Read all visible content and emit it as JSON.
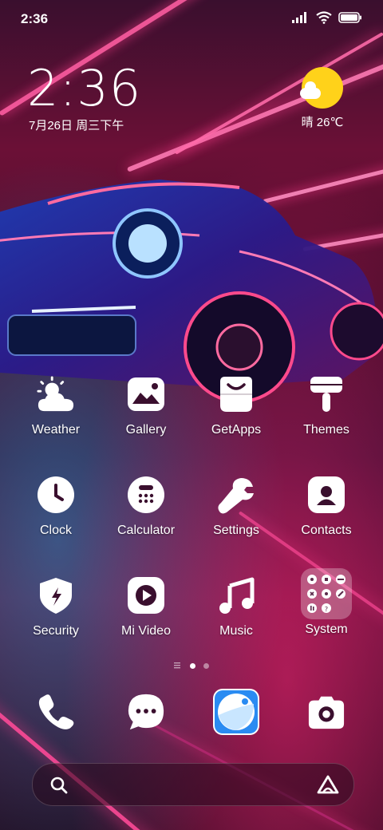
{
  "status_bar": {
    "time": "2:36"
  },
  "widget": {
    "clock": "2:36",
    "date": "7月26日 周三下午",
    "weather": "晴 26℃"
  },
  "apps": [
    {
      "label": "Weather",
      "icon": "weather-icon"
    },
    {
      "label": "Gallery",
      "icon": "gallery-icon"
    },
    {
      "label": "GetApps",
      "icon": "getapps-icon"
    },
    {
      "label": "Themes",
      "icon": "themes-icon"
    },
    {
      "label": "Clock",
      "icon": "clock-icon"
    },
    {
      "label": "Calculator",
      "icon": "calculator-icon"
    },
    {
      "label": "Settings",
      "icon": "settings-wrench-icon"
    },
    {
      "label": "Contacts",
      "icon": "contacts-icon"
    },
    {
      "label": "Security",
      "icon": "security-shield-icon"
    },
    {
      "label": "Mi Video",
      "icon": "mi-video-icon"
    },
    {
      "label": "Music",
      "icon": "music-icon"
    },
    {
      "label": "System",
      "icon": "system-folder-icon"
    }
  ],
  "dock": [
    {
      "icon": "phone-icon"
    },
    {
      "icon": "messaging-icon"
    },
    {
      "icon": "browser-icon"
    },
    {
      "icon": "camera-icon"
    }
  ],
  "colors": {
    "accent_pink": "#ff3c8c",
    "accent_blue": "#2a8bf2",
    "sun": "#ffd21a"
  }
}
